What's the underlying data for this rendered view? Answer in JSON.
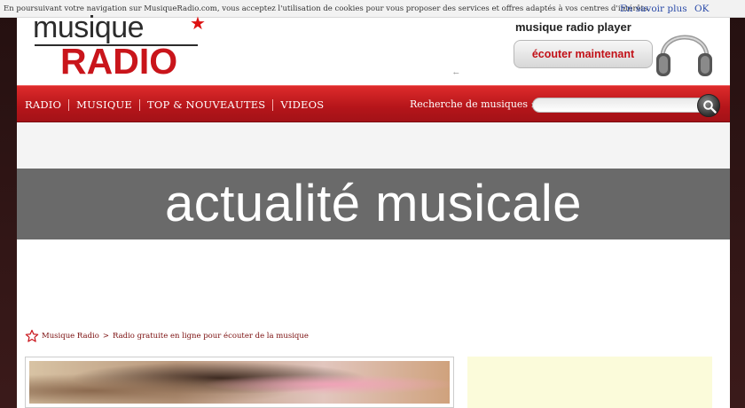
{
  "cookie_bar": {
    "text": "En poursuivant votre navigation sur MusiqueRadio.com, vous acceptez l'utilisation de cookies pour vous proposer des services et offres adaptés à vos centres d'intérêts.",
    "more_label": "En savoir plus",
    "ok_label": "OK"
  },
  "header": {
    "logo_top": "musique",
    "logo_bottom": "RADIO",
    "player_title": "musique radio player",
    "player_button": "écouter maintenant"
  },
  "nav": {
    "items": [
      {
        "label": "RADIO"
      },
      {
        "label": "MUSIQUE"
      },
      {
        "label": "TOP & NOUVEAUTES"
      },
      {
        "label": "VIDEOS"
      }
    ],
    "search_label": "Recherche de musiques :",
    "search_value": ""
  },
  "title_overlay": "actualité musicale",
  "breadcrumb": {
    "home": "Musique Radio",
    "separator": ">",
    "current": "Radio gratuite en ligne pour écouter de la musique"
  },
  "colors": {
    "brand_red": "#c9151b",
    "nav_red": "#b5151a",
    "link_blue": "#2a4aa8"
  },
  "icons": [
    "star-icon",
    "search-icon",
    "headphones-icon"
  ]
}
